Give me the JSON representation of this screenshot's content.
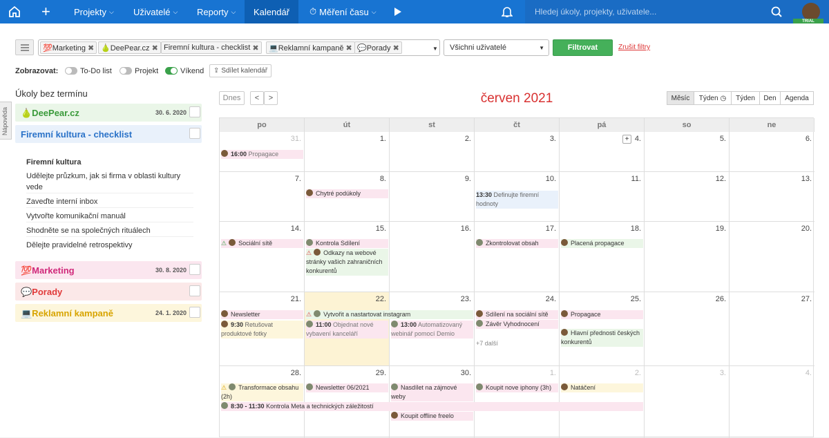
{
  "nav": {
    "items": [
      "Projekty",
      "Uživatelé",
      "Reporty",
      "Kalendář",
      "Měření času"
    ],
    "search_placeholder": "Hledej úkoly, projekty, uživatele...",
    "trial": "TRIAL"
  },
  "filters": {
    "tags": [
      "💯Marketing",
      "🍐DeePear.cz",
      "Firemní kultura - checklist",
      "💻Reklamní kampaně",
      "💬Porady"
    ],
    "users": "Všichni uživatelé",
    "filter_button": "Filtrovat",
    "reset": "Zrušit filtry"
  },
  "display": {
    "label": "Zobrazovat:",
    "todo": "To-Do list",
    "project": "Projekt",
    "weekend": "Víkend",
    "share": "Sdílet kalendář"
  },
  "help_tab": "Nápověda",
  "sidebar": {
    "title": "Úkoly bez termínu",
    "projects": [
      {
        "name": "🍐DeePear.cz",
        "date": "30. 6. 2020",
        "color": "#3a9a3a",
        "bg": "#eaf6e8"
      },
      {
        "name": "Firemní kultura - checklist",
        "date": "",
        "color": "#2a72c8",
        "bg": "#e9f1fb"
      },
      {
        "name": "💯Marketing",
        "date": "30. 8. 2020",
        "color": "#d0287a",
        "bg": "#fbe6ef"
      },
      {
        "name": "💬Porady",
        "date": "",
        "color": "#e03a3a",
        "bg": "#fbe8e8"
      },
      {
        "name": "💻Reklamní kampaně",
        "date": "24. 1. 2020",
        "color": "#d8a400",
        "bg": "#fdf6dc"
      }
    ],
    "checklist_title": "Firemní kultura",
    "checklist": [
      "Udělejte průzkum, jak si firma v oblasti kultury vede",
      "Zaveďte interní inbox",
      "Vytvořte komunikační manuál",
      "Shodněte se na společných rituálech",
      "Dělejte pravidelné retrospektivy"
    ]
  },
  "calendar": {
    "today_btn": "Dnes",
    "prev": "<",
    "next": ">",
    "title": "červen 2021",
    "views": [
      "Měsíc",
      "Týden",
      "Týden",
      "Den",
      "Agenda"
    ],
    "days": [
      "po",
      "út",
      "st",
      "čt",
      "pá",
      "so",
      "ne"
    ],
    "weeks": [
      [
        "31.",
        "1.",
        "2.",
        "3.",
        "4.",
        "5.",
        "6."
      ],
      [
        "7.",
        "8.",
        "9.",
        "10.",
        "11.",
        "12.",
        "13."
      ],
      [
        "14.",
        "15.",
        "16.",
        "17.",
        "18.",
        "19.",
        "20."
      ],
      [
        "21.",
        "22.",
        "23.",
        "24.",
        "25.",
        "26.",
        "27."
      ],
      [
        "28.",
        "29.",
        "30.",
        "1.",
        "2.",
        "3.",
        "4."
      ]
    ],
    "events": {
      "e1t": "16:00",
      "e1": "Propagace",
      "e2": "Chytré podúkoly",
      "e3t": "13:30",
      "e3": "Definujte firemní hodnoty",
      "e4": "Sociální sítě",
      "e5": "Kontrola Sdílení",
      "e6": "Odkazy na webové stránky vašich zahraničních konkurentů",
      "e7": "Zkontrolovat obsah",
      "e8": "Placená propagace",
      "e9": "Newsletter",
      "e10": "Vytvořit a nastartovat instagram",
      "e11t": "9:30",
      "e11": "Retušovat produktové fotky",
      "e12t": "11:00",
      "e12": "Objednat nové vybavení kanceláří",
      "e13t": "13:00",
      "e13": "Automatizovaný webinář pomocí Demio",
      "e14": "Sdílení na sociální sítě",
      "e15": "Závěr Vyhodnocení",
      "e16": "+7 další",
      "e17": "Propagace",
      "e18": "Hlavní přednosti českých konkurentů",
      "e19": "Transformace obsahu (2h)",
      "e20": "Newsletter 06/2021",
      "e21": "Nasdílet na zájmové weby",
      "e22": "Koupit nove iphony (3h)",
      "e23": "Natáčení",
      "e24t": "8:30 - 11:30",
      "e24": "Kontrola Meta a technických záležitostí",
      "e25": "Koupit offline freelo"
    }
  }
}
